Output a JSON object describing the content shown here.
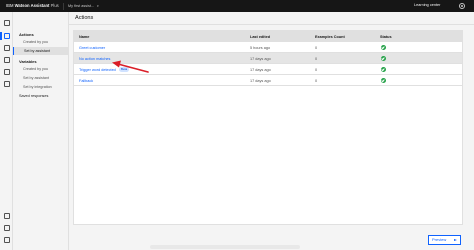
{
  "topbar": {
    "brand_prefix": "IBM",
    "brand_name": "Watson Assistant",
    "brand_plan": "Plus",
    "assistant_selector": "My first assist...",
    "learning_center": "Learning center",
    "icons": [
      "settings-icon"
    ]
  },
  "rail": {
    "icons": [
      "home-icon",
      "actions-icon",
      "analytics-icon",
      "integrations-icon",
      "settings-icon",
      "help-icon",
      "user-icon"
    ]
  },
  "subnav": {
    "actions_heading": "Actions",
    "actions_items": [
      "Created by you",
      "Set by assistant"
    ],
    "variables_heading": "Variables",
    "variables_items": [
      "Created by you",
      "Set by assistant",
      "Set by integration"
    ],
    "saved_responses": "Saved responses"
  },
  "page": {
    "title": "Actions"
  },
  "table": {
    "columns": [
      "Name",
      "Last edited",
      "Examples Count",
      "Status"
    ],
    "rows": [
      {
        "name": "Greet customer",
        "last_edited": "5 hours ago",
        "examples": "0",
        "status": "ok"
      },
      {
        "name": "No action matches",
        "last_edited": "17 days ago",
        "examples": "0",
        "status": "ok"
      },
      {
        "name": "Trigger word detected",
        "badge": "Beta",
        "last_edited": "17 days ago",
        "examples": "0",
        "status": "ok"
      },
      {
        "name": "Fallback",
        "last_edited": "17 days ago",
        "examples": "0",
        "status": "ok"
      }
    ]
  },
  "footer": {
    "preview_label": "Preview"
  },
  "colors": {
    "accent": "#0f62fe",
    "success": "#24a148",
    "annotation_arrow": "#da1e28",
    "topbar": "#161616"
  }
}
